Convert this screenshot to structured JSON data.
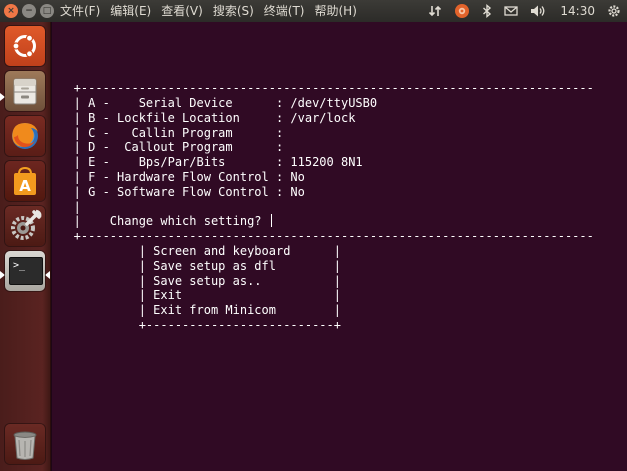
{
  "top_panel": {
    "window_controls": {
      "close": "×",
      "minimize": "−",
      "maximize": "□"
    },
    "menus": [
      "文件(F)",
      "编辑(E)",
      "查看(V)",
      "搜索(S)",
      "终端(T)",
      "帮助(H)"
    ],
    "clock": "14:30"
  },
  "launcher": {
    "items": [
      {
        "name": "ubuntu-dash",
        "icon": "ubuntu-logo-icon"
      },
      {
        "name": "files",
        "icon": "file-cabinet-icon"
      },
      {
        "name": "firefox",
        "icon": "firefox-icon"
      },
      {
        "name": "software-center",
        "icon": "shopping-bag-icon"
      },
      {
        "name": "system-settings",
        "icon": "wrench-gear-icon"
      },
      {
        "name": "terminal",
        "icon": "terminal-icon"
      },
      {
        "name": "trash",
        "icon": "trash-icon"
      }
    ],
    "terminal_prompt": ">_",
    "software_center_letter": "A"
  },
  "terminal": {
    "lines": [
      "",
      "",
      "",
      "",
      "   +-----------------------------------------------------------------------",
      "   | A -    Serial Device      : /dev/ttyUSB0",
      "   | B - Lockfile Location     : /var/lock",
      "   | C -   Callin Program      :",
      "   | D -  Callout Program      :",
      "   | E -    Bps/Par/Bits       : 115200 8N1",
      "   | F - Hardware Flow Control : No",
      "   | G - Software Flow Control : No",
      "   |",
      "   |    Change which setting? ",
      "   +-----------------------------------------------------------------------",
      "            | Screen and keyboard      |",
      "            | Save setup as dfl        |",
      "            | Save setup as..          |",
      "            | Exit                     |",
      "            | Exit from Minicom        |",
      "            +--------------------------+"
    ]
  },
  "colors": {
    "terminal_bg": "#300a24",
    "terminal_fg": "#ffffff",
    "panel_bg": "#3c3b37",
    "launcher_bg": "#5a2321",
    "close_button": "#f07746",
    "dash_orange": "#dd4814"
  }
}
